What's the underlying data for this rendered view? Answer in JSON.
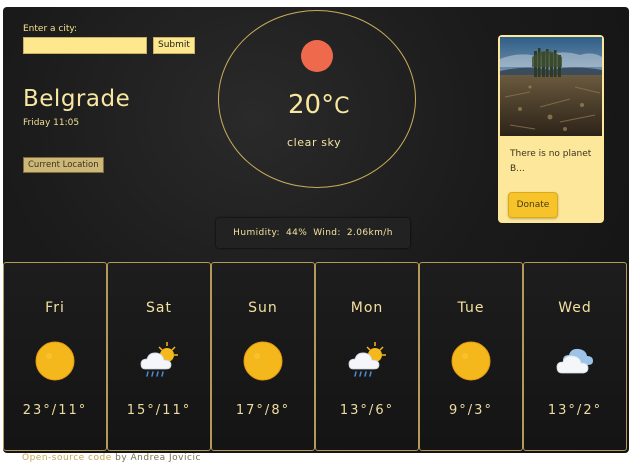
{
  "search": {
    "label": "Enter a city:",
    "value": "",
    "placeholder": "",
    "submit_label": "Submit"
  },
  "current": {
    "city": "Belgrade",
    "datetime": "Friday 11:05",
    "location_button": "Current Location",
    "temperature": "20°",
    "unit": "C",
    "description": "clear sky",
    "humidity_label": "Humidity:",
    "humidity": "44%",
    "wind_label": "Wind:",
    "wind": "2.06km/h",
    "sun_color": "#ef6a4c"
  },
  "donate": {
    "text": "There is no planet B...",
    "button_label": "Donate"
  },
  "forecast": [
    {
      "day": "Fri",
      "icon": "sun-icon",
      "temps": "23°/11°"
    },
    {
      "day": "Sat",
      "icon": "rain-cloud-sun-icon",
      "temps": "15°/11°"
    },
    {
      "day": "Sun",
      "icon": "sun-icon",
      "temps": "17°/8°"
    },
    {
      "day": "Mon",
      "icon": "rain-cloud-sun-icon",
      "temps": "13°/6°"
    },
    {
      "day": "Tue",
      "icon": "sun-icon",
      "temps": "9°/3°"
    },
    {
      "day": "Wed",
      "icon": "cloud-icon",
      "temps": "13°/2°"
    }
  ],
  "footer": {
    "link_text": "Open-source code",
    "author": "by Andrea Jovicic"
  },
  "colors": {
    "accent": "#fde88d",
    "text_gold": "#f3e0a0",
    "background": "#1b1b1b"
  }
}
